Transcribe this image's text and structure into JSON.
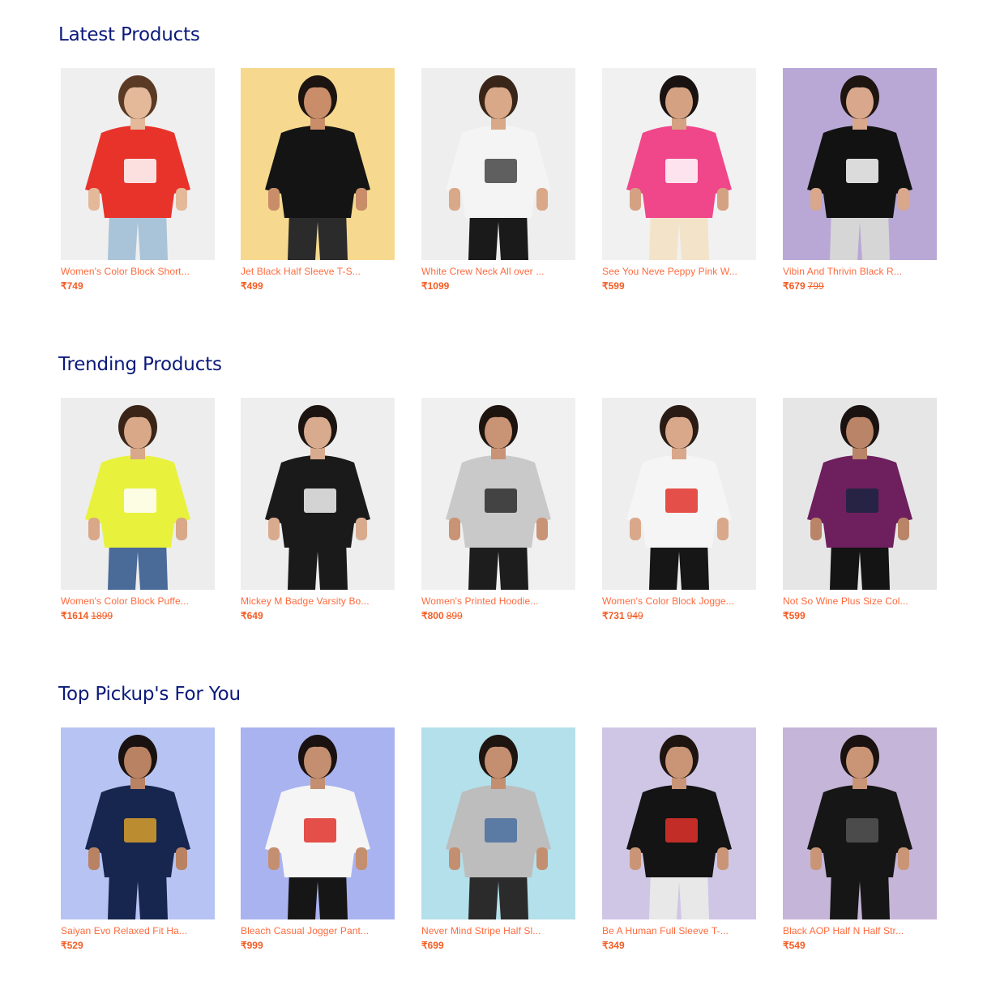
{
  "sections": [
    {
      "title": "Latest Products",
      "products": [
        {
          "name": "Women's Color Block Short...",
          "price": "₹749",
          "old_price": "",
          "bg": "#efefef",
          "skin": "#e3b99a",
          "hair": "#5a3a24",
          "top": "#e8332b",
          "accent": "#ffffff",
          "bottom": "#a9c4d9"
        },
        {
          "name": "Jet Black Half Sleeve T-S...",
          "price": "₹499",
          "old_price": "",
          "bg": "#f6d98e",
          "skin": "#c98e69",
          "hair": "#1c1410",
          "top": "#141414",
          "accent": "#141414",
          "bottom": "#2b2b2b"
        },
        {
          "name": "White Crew Neck All over ...",
          "price": "₹1099",
          "old_price": "",
          "bg": "#eeeeee",
          "skin": "#d9a888",
          "hair": "#3a2618",
          "top": "#f4f4f4",
          "accent": "#444444",
          "bottom": "#1a1a1a"
        },
        {
          "name": "See You Neve Peppy Pink W...",
          "price": "₹599",
          "old_price": "",
          "bg": "#f1f1f1",
          "skin": "#d4a283",
          "hair": "#1a1210",
          "top": "#f0468a",
          "accent": "#ffffff",
          "bottom": "#f3e3c8"
        },
        {
          "name": "Vibin And Thrivin Black R...",
          "price": "₹679",
          "old_price": "799",
          "bg": "#b9a8d6",
          "skin": "#d9a78b",
          "hair": "#1e1410",
          "top": "#121212",
          "accent": "#ffffff",
          "bottom": "#d6d6d6"
        }
      ]
    },
    {
      "title": "Trending Products",
      "products": [
        {
          "name": "Women's Color Block Puffe...",
          "price": "₹1614",
          "old_price": "1899",
          "bg": "#ededed",
          "skin": "#d8a889",
          "hair": "#3a2418",
          "top": "#e8f23c",
          "accent": "#ffffff",
          "bottom": "#4a6a98"
        },
        {
          "name": "Mickey M Badge Varsity Bo...",
          "price": "₹649",
          "old_price": "",
          "bg": "#eeeeee",
          "skin": "#d9ab8e",
          "hair": "#1c1410",
          "top": "#1a1a1a",
          "accent": "#f5f5f5",
          "bottom": "#1a1a1a"
        },
        {
          "name": "Women's Printed Hoodie...",
          "price": "₹800",
          "old_price": "899",
          "bg": "#f0f0f0",
          "skin": "#c99375",
          "hair": "#1d1410",
          "top": "#c9c9c9",
          "accent": "#2b2b2b",
          "bottom": "#1d1d1d"
        },
        {
          "name": "Women's Color Block Jogge...",
          "price": "₹731",
          "old_price": "949",
          "bg": "#eeeeee",
          "skin": "#d9a88a",
          "hair": "#2a1c14",
          "top": "#f5f5f5",
          "accent": "#e0322a",
          "bottom": "#161616"
        },
        {
          "name": "Not So Wine Plus Size Col...",
          "price": "₹599",
          "old_price": "",
          "bg": "#e6e6e6",
          "skin": "#b98467",
          "hair": "#1a1210",
          "top": "#6e1f5e",
          "accent": "#1b2440",
          "bottom": "#141414"
        }
      ]
    },
    {
      "title": "Top Pickup's For You",
      "products": [
        {
          "name": "Saiyan Evo Relaxed Fit Ha...",
          "price": "₹529",
          "old_price": "",
          "bg": "#b7c3f2",
          "skin": "#b98263",
          "hair": "#1a1210",
          "top": "#16264e",
          "accent": "#d9a02c",
          "bottom": "#16264e"
        },
        {
          "name": "Bleach Casual Jogger Pant...",
          "price": "₹999",
          "old_price": "",
          "bg": "#a9b3f0",
          "skin": "#c48f70",
          "hair": "#1a1210",
          "top": "#f5f5f5",
          "accent": "#e0322a",
          "bottom": "#161616"
        },
        {
          "name": "Never Mind Stripe Half Sl...",
          "price": "₹699",
          "old_price": "",
          "bg": "#b3e0ea",
          "skin": "#c48f70",
          "hair": "#1e1410",
          "top": "#bdbdbd",
          "accent": "#4a6fa0",
          "bottom": "#2b2b2b"
        },
        {
          "name": "Be A Human Full Sleeve T-...",
          "price": "₹349",
          "old_price": "",
          "bg": "#cfc6e6",
          "skin": "#c99576",
          "hair": "#1e1410",
          "top": "#141414",
          "accent": "#e0322a",
          "bottom": "#e8e8e8"
        },
        {
          "name": "Black AOP Half N Half Str...",
          "price": "₹549",
          "old_price": "",
          "bg": "#c5b5d8",
          "skin": "#c99576",
          "hair": "#1a1210",
          "top": "#161616",
          "accent": "#555555",
          "bottom": "#161616"
        }
      ]
    }
  ]
}
